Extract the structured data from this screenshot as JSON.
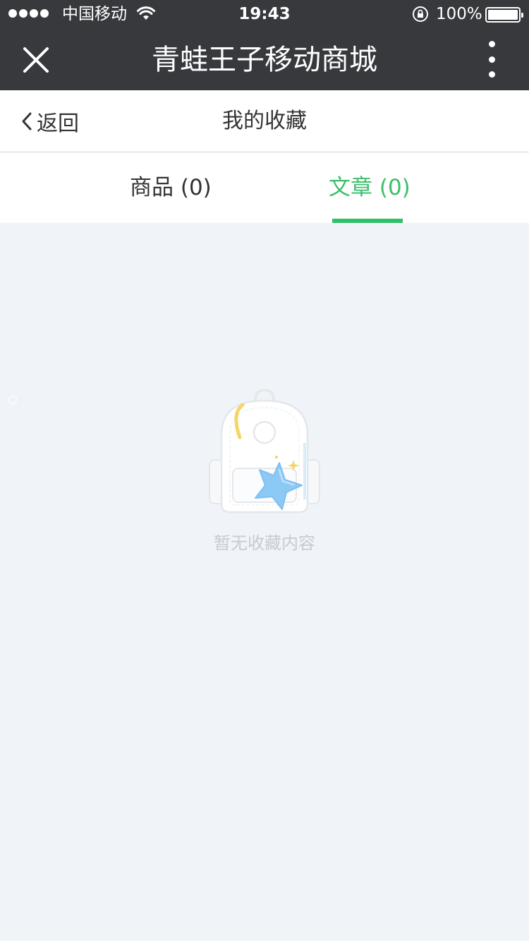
{
  "status_bar": {
    "carrier": "中国移动",
    "time": "19:43",
    "battery": "100%",
    "signal_bars_filled": 4,
    "signal_bars_total": 5
  },
  "nav": {
    "title": "青蛙王子移动商城",
    "close_icon": "close-icon",
    "more_icon": "more-vertical-icon"
  },
  "header": {
    "back_label": "返回",
    "title": "我的收藏"
  },
  "tabs": [
    {
      "label": "商品 (0)",
      "active": false
    },
    {
      "label": "文章 (0)",
      "active": true
    }
  ],
  "empty_state": {
    "illustration": "backpack-star-icon",
    "text": "暂无收藏内容"
  },
  "colors": {
    "nav_bg": "#37393d",
    "accent": "#2fc167",
    "page_bg": "#f0f4f8",
    "empty_text": "#c6cbd0"
  }
}
